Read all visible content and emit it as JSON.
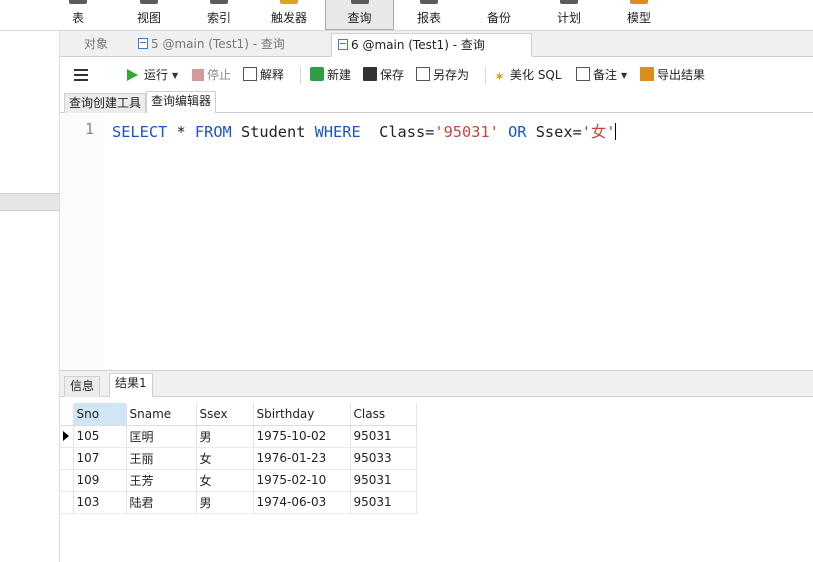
{
  "ribbon": {
    "buttons": [
      {
        "label": "表",
        "icon": "table-icon"
      },
      {
        "label": "视图",
        "icon": "view-icon"
      },
      {
        "label": "索引",
        "icon": "index-icon"
      },
      {
        "label": "触发器",
        "icon": "trigger-icon"
      },
      {
        "label": "查询",
        "icon": "query-icon",
        "active": true
      },
      {
        "label": "报表",
        "icon": "report-icon"
      },
      {
        "label": "备份",
        "icon": "backup-icon"
      },
      {
        "label": "计划",
        "icon": "schedule-icon"
      },
      {
        "label": "模型",
        "icon": "model-icon"
      }
    ]
  },
  "doc_tabs": [
    {
      "label": "对象"
    },
    {
      "label": "5 @main (Test1) - 查询"
    },
    {
      "label": "6 @main (Test1) - 查询",
      "active": true
    }
  ],
  "toolbar": {
    "run": "运行",
    "stop": "停止",
    "explain": "解释",
    "new": "新建",
    "save": "保存",
    "save_as": "另存为",
    "beautify": "美化 SQL",
    "note": "备注",
    "export": "导出结果"
  },
  "sub_tabs": [
    {
      "label": "查询创建工具"
    },
    {
      "label": "查询编辑器",
      "active": true
    }
  ],
  "editor": {
    "line_number": "1",
    "tokens": {
      "select": "SELECT",
      "star": " * ",
      "from": "FROM",
      "table": " Student ",
      "where": "WHERE",
      "cond1": "  Class=",
      "val1": "'95031'",
      "sp": " ",
      "or": "OR",
      "cond2": " Ssex=",
      "val2": "'女'"
    }
  },
  "result_tabs": [
    {
      "label": "信息"
    },
    {
      "label": "结果1",
      "active": true
    }
  ],
  "grid": {
    "columns": [
      "Sno",
      "Sname",
      "Ssex",
      "Sbirthday",
      "Class"
    ],
    "rows": [
      [
        "105",
        "匡明",
        "男",
        "1975-10-02",
        "95031"
      ],
      [
        "107",
        "王丽",
        "女",
        "1976-01-23",
        "95033"
      ],
      [
        "109",
        "王芳",
        "女",
        "1975-02-10",
        "95031"
      ],
      [
        "103",
        "陆君",
        "男",
        "1974-06-03",
        "95031"
      ]
    ]
  }
}
